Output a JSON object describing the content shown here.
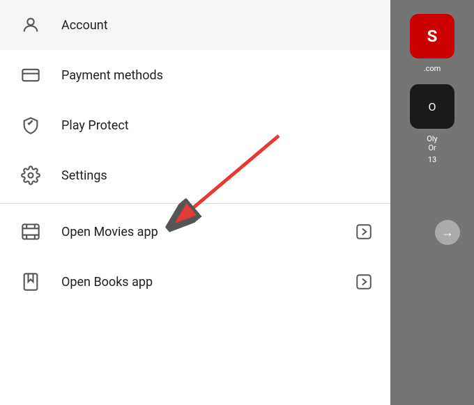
{
  "menu": {
    "items": [
      {
        "id": "account",
        "label": "Account",
        "icon": "person",
        "hasArrow": false
      },
      {
        "id": "payment-methods",
        "label": "Payment methods",
        "icon": "credit-card",
        "hasArrow": false
      },
      {
        "id": "play-protect",
        "label": "Play Protect",
        "icon": "shield",
        "hasArrow": false
      },
      {
        "id": "settings",
        "label": "Settings",
        "icon": "gear",
        "hasArrow": false
      }
    ],
    "divider_after_index": 3,
    "bottom_items": [
      {
        "id": "open-movies",
        "label": "Open Movies app",
        "icon": "film",
        "hasArrow": true
      },
      {
        "id": "open-books",
        "label": "Open Books app",
        "icon": "bookmark",
        "hasArrow": true
      }
    ]
  },
  "right_panel": {
    "app1_text": ".com",
    "app2_line1": "Oly",
    "app2_line2": "Or",
    "app2_count": "13",
    "arrow_text": "→"
  },
  "arrow_annotation": {
    "label": "red arrow pointing to Settings"
  }
}
